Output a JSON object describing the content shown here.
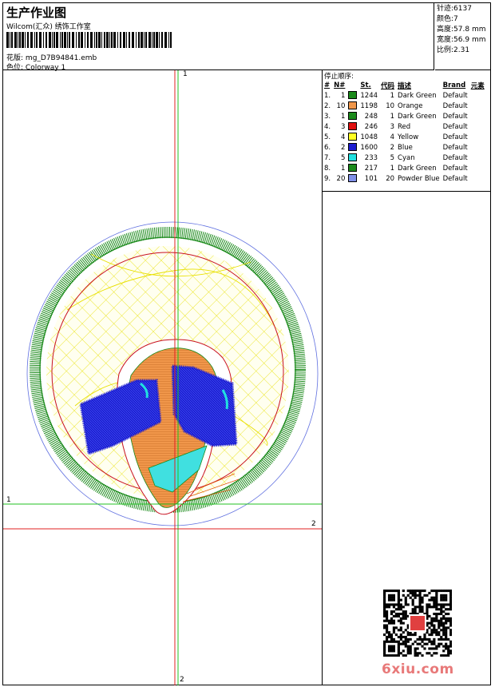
{
  "header": {
    "title": "生产作业图",
    "company": "Wilcom(汇众) 绣饰工作室",
    "design_label": "花版:",
    "design_file": "mg_D7B94841.emb",
    "colorway_label": "色位:",
    "colorway": "Colorway 1"
  },
  "stats": [
    {
      "label": "针迹:",
      "value": "6137"
    },
    {
      "label": "颜色:",
      "value": "7"
    },
    {
      "label": "高度:",
      "value": "57.8 mm"
    },
    {
      "label": "宽度:",
      "value": "56.9 mm"
    },
    {
      "label": "比例:",
      "value": "2.31"
    }
  ],
  "stop_sequence": {
    "title": "停止顺序:",
    "columns": [
      "#",
      "N#",
      "St.",
      "代码",
      "描述",
      "Brand",
      "元素"
    ],
    "rows": [
      {
        "idx": "1.",
        "n": "1",
        "color": "#1b8a1b",
        "st": "1244",
        "code": "1",
        "desc": "Dark Green",
        "brand": "Default"
      },
      {
        "idx": "2.",
        "n": "10",
        "color": "#f0964a",
        "st": "1198",
        "code": "10",
        "desc": "Orange",
        "brand": "Default"
      },
      {
        "idx": "3.",
        "n": "1",
        "color": "#1b8a1b",
        "st": "248",
        "code": "1",
        "desc": "Dark Green",
        "brand": "Default"
      },
      {
        "idx": "4.",
        "n": "3",
        "color": "#e01010",
        "st": "246",
        "code": "3",
        "desc": "Red",
        "brand": "Default"
      },
      {
        "idx": "5.",
        "n": "4",
        "color": "#ffff20",
        "st": "1048",
        "code": "4",
        "desc": "Yellow",
        "brand": "Default"
      },
      {
        "idx": "6.",
        "n": "2",
        "color": "#1c1cd0",
        "st": "1600",
        "code": "2",
        "desc": "Blue",
        "brand": "Default"
      },
      {
        "idx": "7.",
        "n": "5",
        "color": "#20e0e0",
        "st": "233",
        "code": "5",
        "desc": "Cyan",
        "brand": "Default"
      },
      {
        "idx": "8.",
        "n": "1",
        "color": "#1b8a1b",
        "st": "217",
        "code": "1",
        "desc": "Dark Green",
        "brand": "Default"
      },
      {
        "idx": "9.",
        "n": "20",
        "color": "#8090e8",
        "st": "101",
        "code": "20",
        "desc": "Powder Blue",
        "brand": "Default"
      }
    ]
  },
  "axes": {
    "v1_label": "1",
    "v2_label": "2",
    "h1_label": "1",
    "h2_label": "2"
  },
  "watermark": "6xiu.com"
}
